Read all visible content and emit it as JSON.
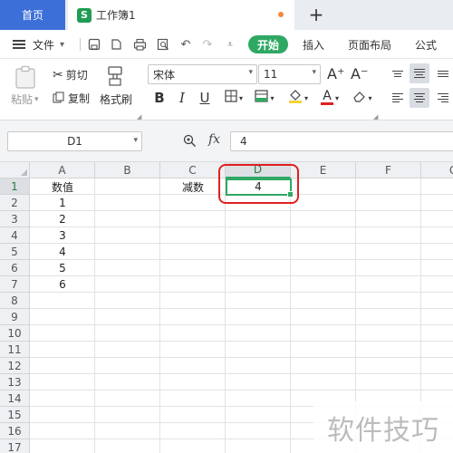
{
  "tabs": {
    "home_label": "首页",
    "doc_icon_letter": "S",
    "doc_title": "工作簿1",
    "add_label": "+"
  },
  "menu": {
    "file_label": "文件",
    "items": [
      "开始",
      "插入",
      "页面布局",
      "公式"
    ]
  },
  "ribbon": {
    "paste_label": "粘贴",
    "cut_label": "剪切",
    "copy_label": "复制",
    "format_painter_label": "格式刷",
    "font_name": "宋体",
    "font_size": "11",
    "bold": "B",
    "italic": "I",
    "underline": "U",
    "grow_font": "A⁺",
    "shrink_font": "A⁻"
  },
  "formula_bar": {
    "cell_ref": "D1",
    "fx_label": "fx",
    "value": "4"
  },
  "sheet": {
    "columns": [
      "A",
      "B",
      "C",
      "D",
      "E",
      "F",
      "G"
    ],
    "rows": [
      "1",
      "2",
      "3",
      "4",
      "5",
      "6",
      "7",
      "8",
      "9",
      "10",
      "11",
      "12",
      "13",
      "14",
      "15",
      "16",
      "17"
    ],
    "cells": {
      "A1": "数值",
      "A2": "1",
      "A3": "2",
      "A4": "3",
      "A5": "4",
      "A6": "5",
      "A7": "6",
      "C1": "减数",
      "D1": "4"
    }
  },
  "watermark": "软件技巧",
  "colors": {
    "accent_green": "#2fa863",
    "home_tab_blue": "#3d6fd9",
    "annotation_red": "#e02020"
  }
}
